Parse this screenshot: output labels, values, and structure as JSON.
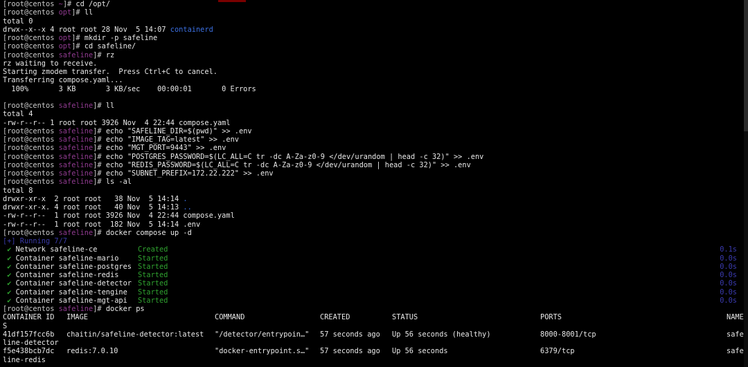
{
  "terminal": {
    "prompt_user": "root@centos",
    "lines_pre": [
      {
        "dir": "~",
        "cmd": "cd /opt/"
      },
      {
        "dir": "opt",
        "cmd": "ll"
      }
    ],
    "total0": "total 0",
    "containerd_line": "drwx--x--x 4 root root 28 Nov  5 14:07 ",
    "containerd_name": "containerd",
    "p_mkdir": {
      "dir": "opt",
      "cmd": "mkdir -p safeline"
    },
    "p_cd": {
      "dir": "opt",
      "cmd": "cd safeline/"
    },
    "p_rz": {
      "dir": "safeline",
      "cmd": "rz"
    },
    "rz_out": [
      "rz waiting to receive.",
      "Starting zmodem transfer.  Press Ctrl+C to cancel.",
      "Transferring compose.yaml...",
      "  100%       3 KB       3 KB/sec    00:00:01       0 Errors"
    ],
    "p_ll": {
      "dir": "safeline",
      "cmd": "ll"
    },
    "ll_out": [
      "total 4",
      "-rw-r--r-- 1 root root 3926 Nov  4 22:44 compose.yaml"
    ],
    "echo_cmds": [
      "echo \"SAFELINE_DIR=$(pwd)\" >> .env",
      "echo \"IMAGE_TAG=latest\" >> .env",
      "echo \"MGT_PORT=9443\" >> .env",
      "echo \"POSTGRES_PASSWORD=$(LC_ALL=C tr -dc A-Za-z0-9 </dev/urandom | head -c 32)\" >> .env",
      "echo \"REDIS_PASSWORD=$(LC_ALL=C tr -dc A-Za-z0-9 </dev/urandom | head -c 32)\" >> .env",
      "echo \"SUBNET_PREFIX=172.22.222\" >> .env"
    ],
    "echo_dir": "safeline",
    "p_ls": {
      "dir": "safeline",
      "cmd": "ls -al"
    },
    "ls_total": "total 8",
    "ls_rows": [
      {
        "text": "drwxr-xr-x  2 root root   38 Nov  5 14:14 ",
        "name": ".",
        "colored": true
      },
      {
        "text": "drwxr-xr-x. 4 root root   40 Nov  5 14:13 ",
        "name": "..",
        "colored": true
      },
      {
        "text": "-rw-r--r--  1 root root 3926 Nov  4 22:44 ",
        "name": "compose.yaml",
        "colored": false
      },
      {
        "text": "-rw-r--r--  1 root root  182 Nov  5 14:14 ",
        "name": ".env",
        "colored": false
      }
    ],
    "p_up": {
      "dir": "safeline",
      "cmd": "docker compose up -d"
    },
    "running_line": "[+] Running 7/7",
    "compose_rows": [
      {
        "item": "Network safeline-ce",
        "status": "Created",
        "time": "0.1s"
      },
      {
        "item": "Container safeline-mario",
        "status": "Started",
        "time": "0.0s"
      },
      {
        "item": "Container safeline-postgres",
        "status": "Started",
        "time": "0.0s"
      },
      {
        "item": "Container safeline-redis",
        "status": "Started",
        "time": "0.0s"
      },
      {
        "item": "Container safeline-detector",
        "status": "Started",
        "time": "0.0s"
      },
      {
        "item": "Container safeline-tengine",
        "status": "Started",
        "time": "0.0s"
      },
      {
        "item": "Container safeline-mgt-api",
        "status": "Started",
        "time": "0.0s"
      }
    ],
    "p_ps": {
      "dir": "safeline",
      "cmd": "docker ps"
    },
    "ps_headers": [
      "CONTAINER ID",
      "IMAGE",
      "COMMAND",
      "CREATED",
      "STATUS",
      "PORTS",
      "NAME"
    ],
    "ps_header_wrap": "S",
    "ps_rows": [
      {
        "id": "41df157fcc6b",
        "image": "chaitin/safeline-detector:latest",
        "command": "\"/detector/entrypoin…\"",
        "created": "57 seconds ago",
        "status": "Up 56 seconds (healthy)",
        "ports": "8000-8001/tcp",
        "name": "safe",
        "wrap": "line-detector"
      },
      {
        "id": "f5e438bcb7dc",
        "image": "redis:7.0.10",
        "command": "\"docker-entrypoint.s…\"",
        "created": "57 seconds ago",
        "status": "Up 56 seconds",
        "ports": "6379/tcp",
        "name": "safe",
        "wrap": "line-redis"
      }
    ]
  },
  "colors": {
    "background": "#000000",
    "prompt_dir": "#8f3a8f",
    "link_blue": "#3b6fe0",
    "status_green": "#2fa12f"
  }
}
